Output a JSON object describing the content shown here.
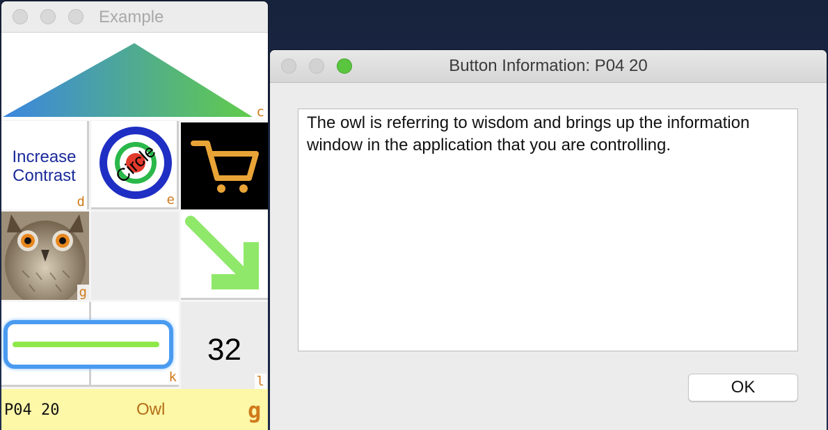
{
  "example_window": {
    "title": "Example",
    "cells": {
      "roof": {
        "key": "c"
      },
      "contrast": {
        "line1": "Increase",
        "line2": "Contrast",
        "key": "d"
      },
      "circle": {
        "word": "Circle",
        "key": "e"
      },
      "cart": {
        "icon": "cart-icon"
      },
      "owl": {
        "key": "g"
      },
      "arrow": {
        "icon": "arrow-down-right-icon"
      },
      "bar": {
        "key": "k"
      },
      "number": {
        "value": "32",
        "key": "l"
      }
    },
    "status": {
      "code": "P04 20",
      "label": "Owl",
      "key": "g"
    },
    "colors": {
      "key_orange": "#d07a1c",
      "status_bg": "#fdf7a8",
      "accent_green": "#8fe86a"
    }
  },
  "dialog": {
    "title": "Button Information: P04 20",
    "message": "The owl is referring to wisdom and brings up the information window in the application that you are controlling.",
    "ok_label": "OK"
  }
}
